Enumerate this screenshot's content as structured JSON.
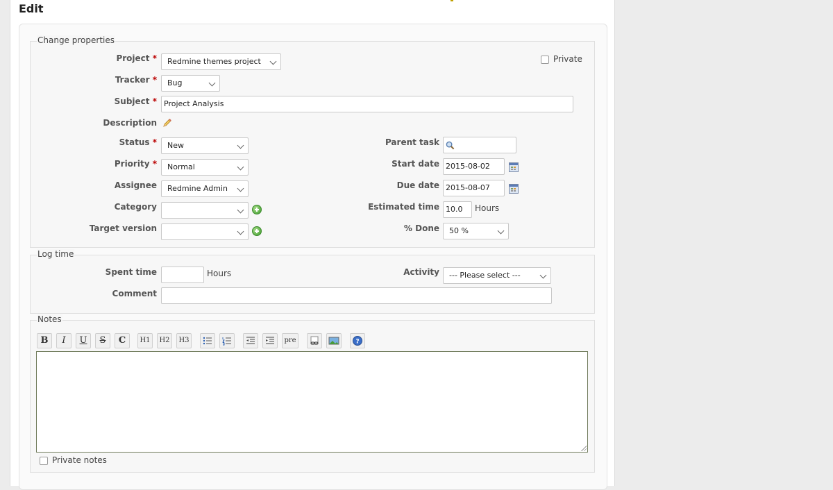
{
  "page_title": "Edit",
  "change_properties": {
    "legend": "Change properties",
    "project": {
      "label": "Project",
      "value": "Redmine themes project"
    },
    "private_label": "Private",
    "tracker": {
      "label": "Tracker",
      "value": "Bug"
    },
    "subject": {
      "label": "Subject",
      "value": "Project Analysis"
    },
    "description": {
      "label": "Description"
    },
    "status": {
      "label": "Status",
      "value": "New"
    },
    "priority": {
      "label": "Priority",
      "value": "Normal"
    },
    "assignee": {
      "label": "Assignee",
      "value": "Redmine Admin"
    },
    "category": {
      "label": "Category",
      "value": ""
    },
    "target_version": {
      "label": "Target version",
      "value": ""
    },
    "parent_task": {
      "label": "Parent task",
      "value": ""
    },
    "start_date": {
      "label": "Start date",
      "value": "2015-08-02"
    },
    "due_date": {
      "label": "Due date",
      "value": "2015-08-07"
    },
    "estimated_time": {
      "label": "Estimated time",
      "value": "10.0",
      "unit": "Hours"
    },
    "done": {
      "label": "% Done",
      "value": "50 %"
    },
    "required_mark": "*"
  },
  "log_time": {
    "legend": "Log time",
    "spent_time": {
      "label": "Spent time",
      "value": "",
      "unit": "Hours"
    },
    "activity": {
      "label": "Activity",
      "value": "--- Please select ---"
    },
    "comment": {
      "label": "Comment",
      "value": ""
    }
  },
  "notes": {
    "legend": "Notes",
    "toolbar": [
      "B",
      "I",
      "U",
      "S",
      "C",
      "H1",
      "H2",
      "H3",
      "ul",
      "ol",
      "indent-left",
      "indent-right",
      "pre",
      "link",
      "image",
      "help"
    ],
    "pre_label": "pre",
    "private_notes_label": "Private notes",
    "value": ""
  },
  "colors": {
    "required": "#bb0000",
    "background": "#ececec",
    "border": "#dedede"
  }
}
